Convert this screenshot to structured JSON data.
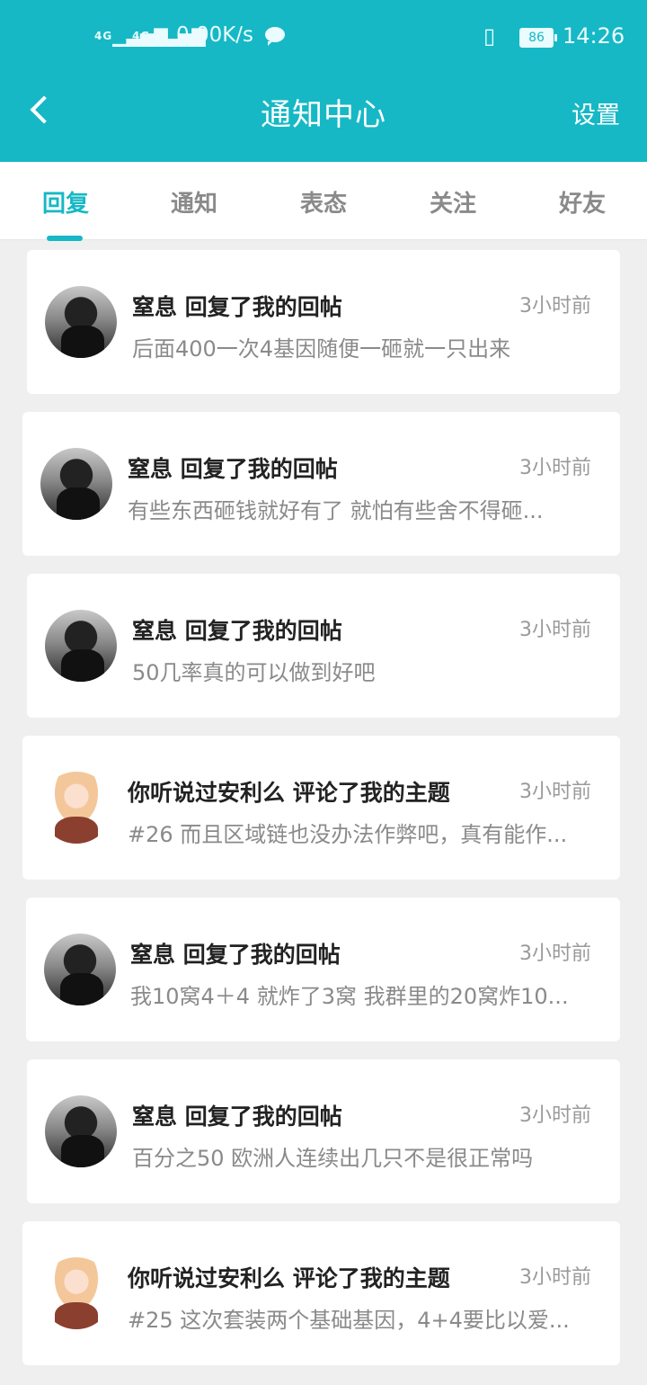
{
  "status_bar": {
    "signal1": "4G",
    "signal2": "4G",
    "speed": "0.00K/s",
    "battery": "86",
    "time": "14:26"
  },
  "header": {
    "title": "通知中心",
    "settings_label": "设置"
  },
  "tabs": [
    {
      "label": "回复"
    },
    {
      "label": "通知"
    },
    {
      "label": "表态"
    },
    {
      "label": "关注"
    },
    {
      "label": "好友"
    }
  ],
  "items": [
    {
      "title": "窒息 回复了我的回帖",
      "time": "3小时前",
      "message": "后面400一次4基因随便一砸就一只出来",
      "avatar": "user-photo"
    },
    {
      "title": "窒息 回复了我的回帖",
      "time": "3小时前",
      "message": "有些东西砸钱就好有了  就怕有些舍不得砸...",
      "avatar": "user-photo"
    },
    {
      "title": "窒息 回复了我的回帖",
      "time": "3小时前",
      "message": "50几率真的可以做到好吧",
      "avatar": "user-photo"
    },
    {
      "title": "你听说过安利么 评论了我的主题",
      "time": "3小时前",
      "message": "#26 而且区域链也没办法作弊吧，真有能作...",
      "avatar": "anime-avatar"
    },
    {
      "title": "窒息 回复了我的回帖",
      "time": "3小时前",
      "message": "我10窝4＋4  就炸了3窝  我群里的20窝炸10...",
      "avatar": "user-photo"
    },
    {
      "title": "窒息 回复了我的回帖",
      "time": "3小时前",
      "message": "百分之50  欧洲人连续出几只不是很正常吗",
      "avatar": "user-photo"
    },
    {
      "title": "你听说过安利么 评论了我的主题",
      "time": "3小时前",
      "message": "#25 这次套装两个基础基因，4+4要比以爱...",
      "avatar": "anime-avatar"
    }
  ],
  "colors": {
    "accent": "#16b8c5",
    "background": "#efefef"
  }
}
